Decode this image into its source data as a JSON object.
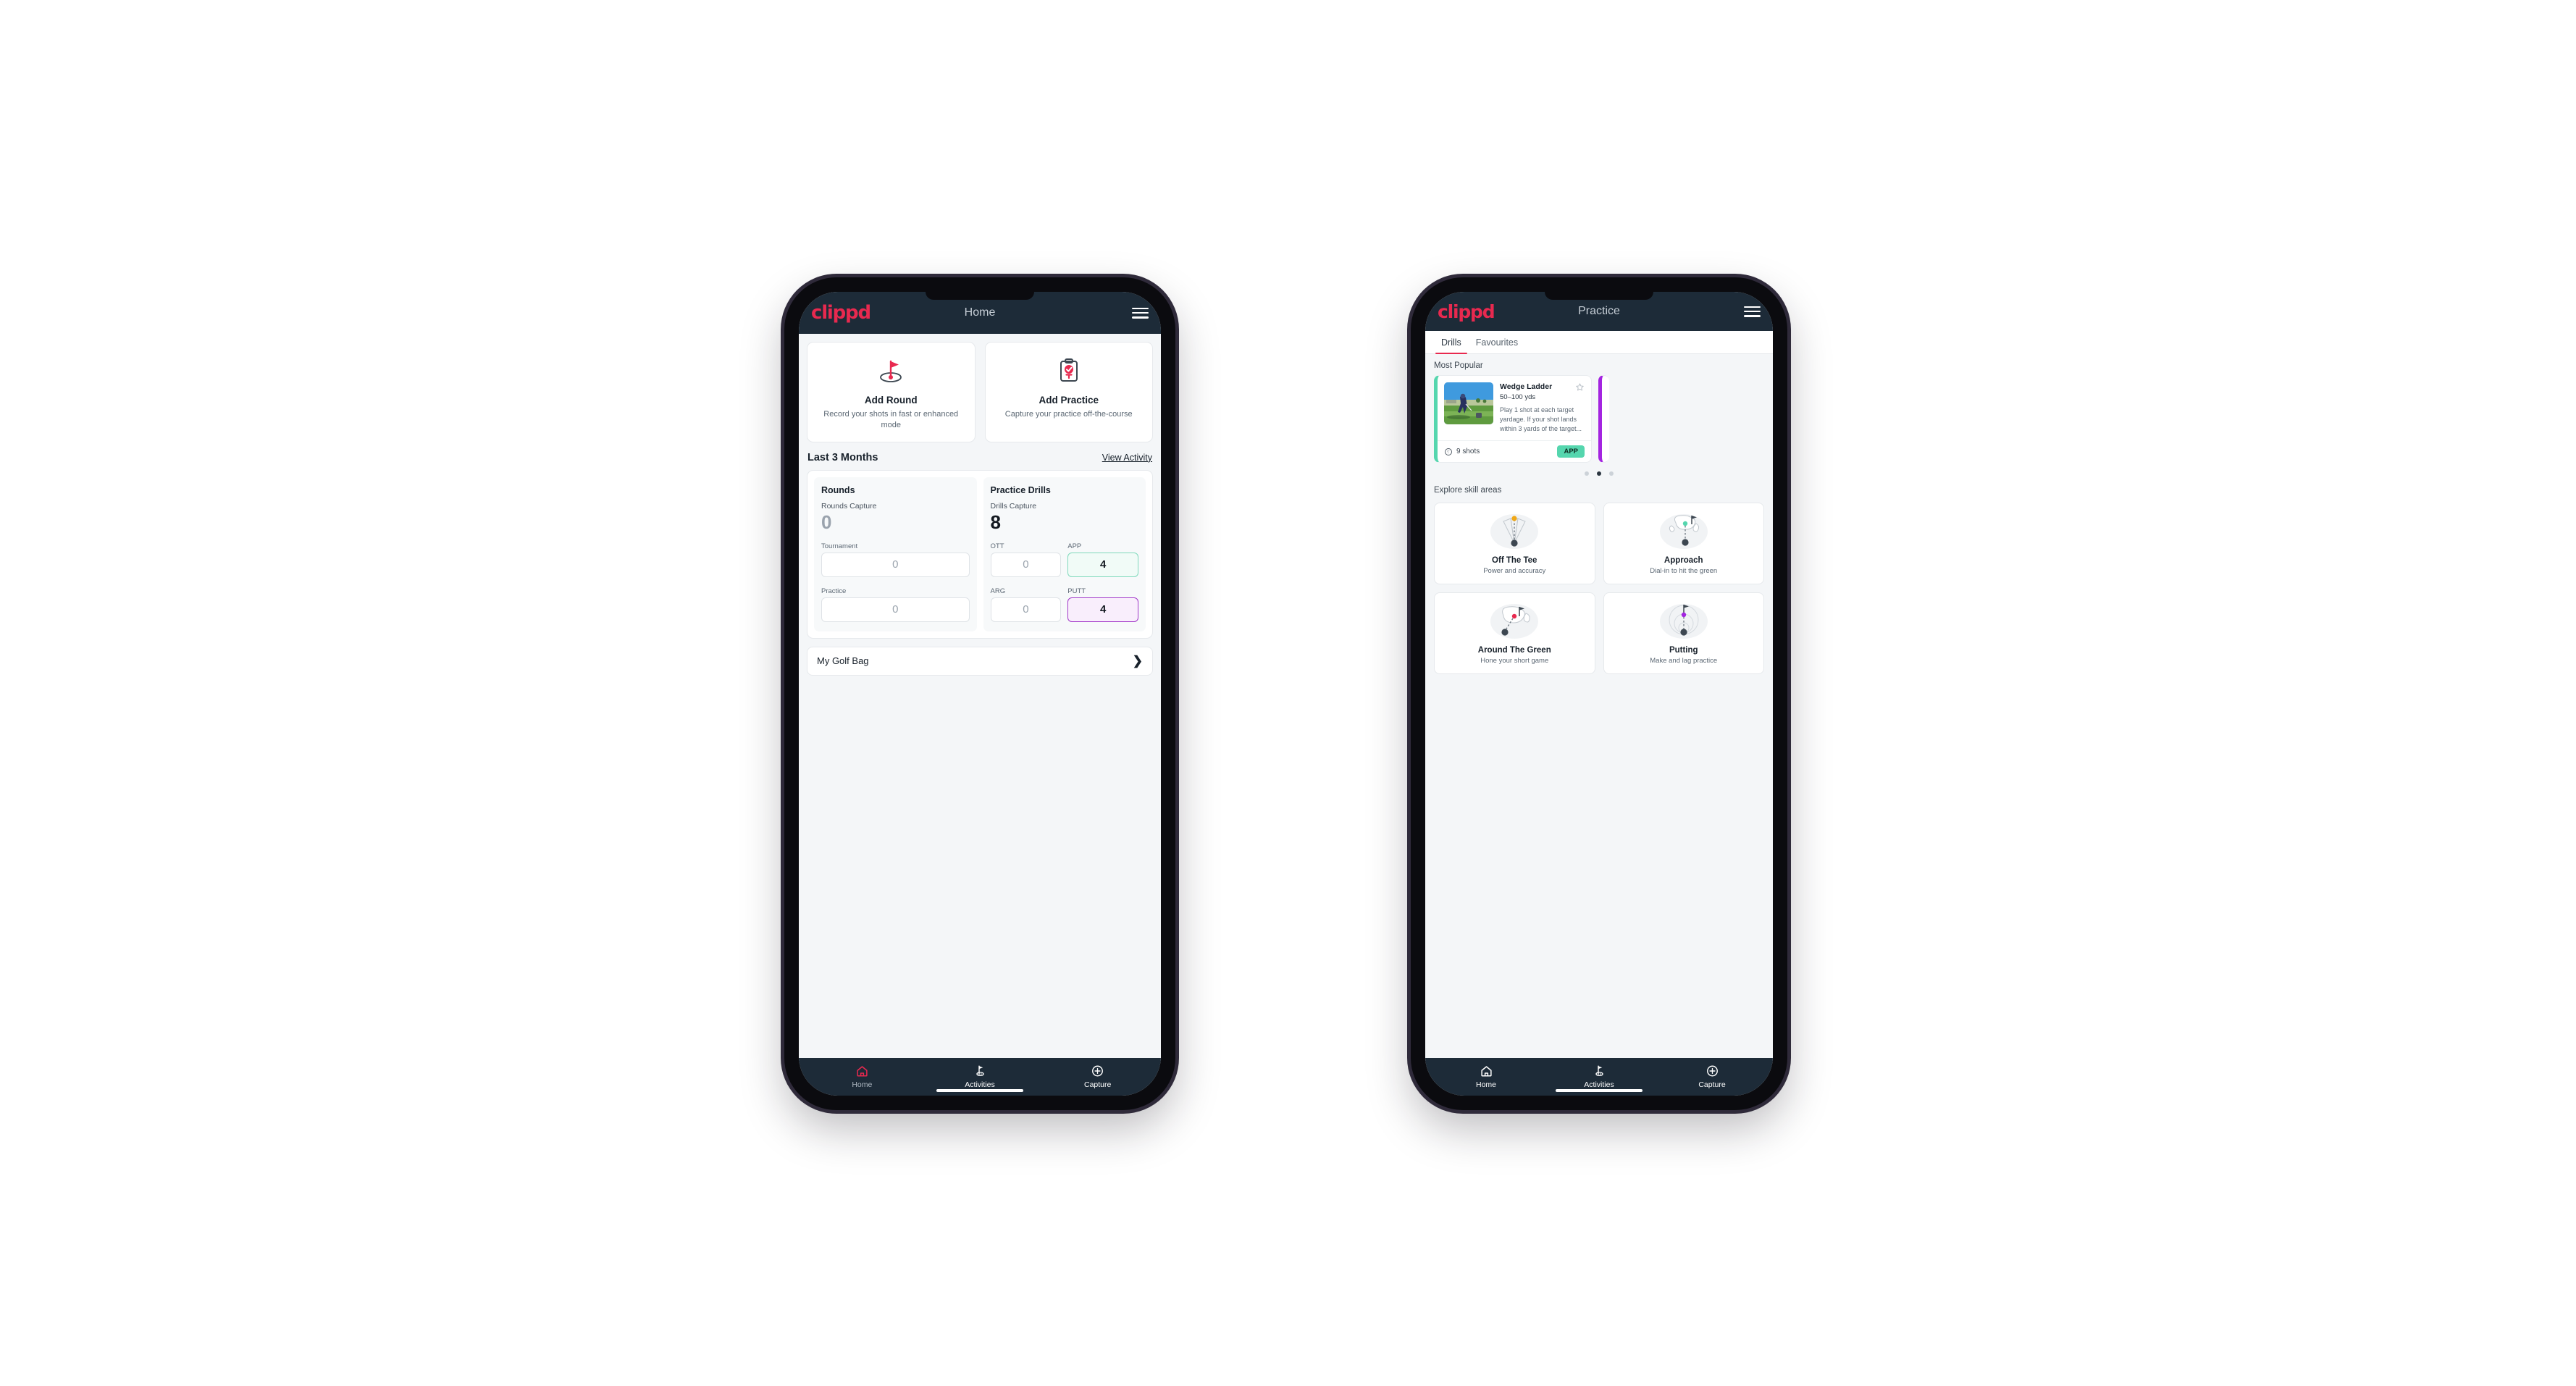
{
  "phone_home": {
    "appbar": {
      "brand": "clippd",
      "title": "Home",
      "menu_icon": "hamburger-menu-icon"
    },
    "actions": [
      {
        "icon": "golf-flag-hole-icon",
        "title": "Add Round",
        "subtitle": "Record your shots in fast or enhanced mode"
      },
      {
        "icon": "clipboard-check-tee-icon",
        "title": "Add Practice",
        "subtitle": "Capture your practice off-the-course"
      }
    ],
    "section": {
      "title": "Last 3 Months",
      "link": "View Activity"
    },
    "stats": {
      "rounds": {
        "title": "Rounds",
        "capture_label": "Rounds Capture",
        "capture_value": "0",
        "fields": [
          {
            "label": "Tournament",
            "value": "0",
            "accent": "none"
          },
          {
            "label": "Practice",
            "value": "0",
            "accent": "none"
          }
        ]
      },
      "drills": {
        "title": "Practice Drills",
        "capture_label": "Drills Capture",
        "capture_value": "8",
        "fields": [
          {
            "label": "OTT",
            "value": "0",
            "accent": "none"
          },
          {
            "label": "APP",
            "value": "4",
            "accent": "green"
          },
          {
            "label": "ARG",
            "value": "0",
            "accent": "none"
          },
          {
            "label": "PUTT",
            "value": "4",
            "accent": "purple"
          }
        ]
      }
    },
    "golf_bag": {
      "label": "My Golf Bag",
      "chevron": "chevron-right-icon"
    },
    "bottom_nav": [
      {
        "icon": "home-icon",
        "label": "Home",
        "active": true
      },
      {
        "icon": "golf-flag-icon",
        "label": "Activities",
        "active": false
      },
      {
        "icon": "plus-circle-icon",
        "label": "Capture",
        "active": false
      }
    ]
  },
  "phone_practice": {
    "appbar": {
      "brand": "clippd",
      "title": "Practice",
      "menu_icon": "hamburger-menu-icon"
    },
    "tabs": [
      {
        "label": "Drills",
        "active": true
      },
      {
        "label": "Favourites",
        "active": false
      }
    ],
    "most_popular_label": "Most Popular",
    "drill_card": {
      "title": "Wedge Ladder",
      "yardage": "50–100 yds",
      "description": "Play 1 shot at each target yardage. If your shot lands within 3 yards of the target...",
      "shots": "9 shots",
      "shots_icon": "golf-ball-icon",
      "badge": "APP",
      "favourite_icon": "star-outline-icon",
      "accent_color": "#55d6ae",
      "thumbnail_alt": "golfer-chipping-photo"
    },
    "next_card_accent": "#a324e0",
    "carousel_dots": {
      "count": 3,
      "active_index": 1
    },
    "skill_section_label": "Explore skill areas",
    "skill_areas": [
      {
        "icon": "tee-shot-dispersion-icon",
        "title": "Off The Tee",
        "subtitle": "Power and accuracy",
        "dot_color": "#f0a818"
      },
      {
        "icon": "approach-green-icon",
        "title": "Approach",
        "subtitle": "Dial-in to hit the green",
        "dot_color": "#55d6ae"
      },
      {
        "icon": "chip-around-green-icon",
        "title": "Around The Green",
        "subtitle": "Hone your short game",
        "dot_color": "#e8294f"
      },
      {
        "icon": "putting-rings-icon",
        "title": "Putting",
        "subtitle": "Make and lag practice",
        "dot_color": "#a324e0"
      }
    ],
    "bottom_nav": [
      {
        "icon": "home-icon",
        "label": "Home",
        "active": false
      },
      {
        "icon": "golf-flag-icon",
        "label": "Activities",
        "active": false
      },
      {
        "icon": "plus-circle-icon",
        "label": "Capture",
        "active": false
      }
    ]
  },
  "colors": {
    "brand_pink": "#e8294f",
    "appbar_navy": "#1d2b38",
    "app_green": "#55d6ae",
    "putt_purple": "#a324e0",
    "page_bg": "#f4f6f8"
  }
}
